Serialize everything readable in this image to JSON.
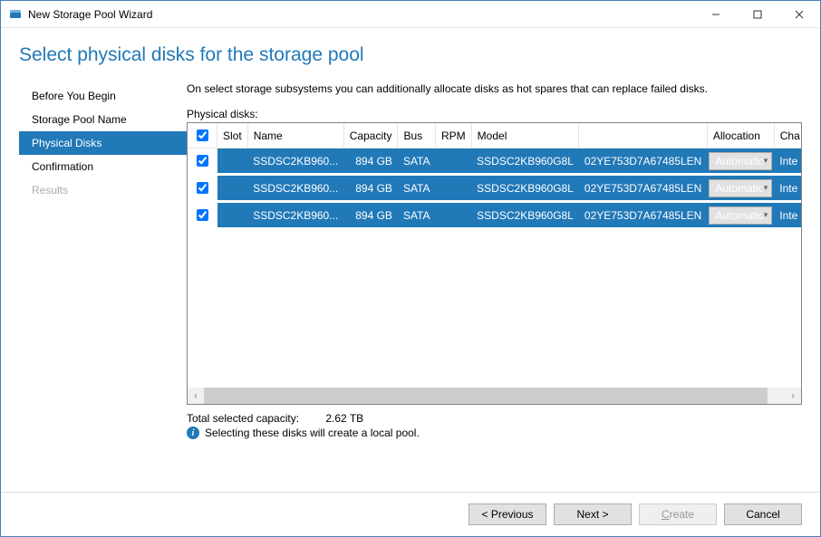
{
  "window": {
    "title": "New Storage Pool Wizard"
  },
  "page": {
    "title": "Select physical disks for the storage pool",
    "intro": "On select storage subsystems you can additionally allocate disks as hot spares that can replace failed disks.",
    "table_label": "Physical disks:"
  },
  "sidebar": {
    "items": [
      {
        "label": "Before You Begin",
        "state": "normal"
      },
      {
        "label": "Storage Pool Name",
        "state": "normal"
      },
      {
        "label": "Physical Disks",
        "state": "active"
      },
      {
        "label": "Confirmation",
        "state": "normal"
      },
      {
        "label": "Results",
        "state": "disabled"
      }
    ]
  },
  "columns": {
    "chk": "",
    "slot": "Slot",
    "name": "Name",
    "capacity": "Capacity",
    "bus": "Bus",
    "rpm": "RPM",
    "model": "Model",
    "allocation": "Allocation",
    "chassis": "Cha"
  },
  "rows": [
    {
      "checked": true,
      "slot": "",
      "name": "SSDSC2KB960...",
      "capacity": "894 GB",
      "bus": "SATA",
      "rpm": "",
      "model": "SSDSC2KB960G8L",
      "serial": "02YE753D7A67485LEN",
      "allocation": "Automatic",
      "chassis": "Inte"
    },
    {
      "checked": true,
      "slot": "",
      "name": "SSDSC2KB960...",
      "capacity": "894 GB",
      "bus": "SATA",
      "rpm": "",
      "model": "SSDSC2KB960G8L",
      "serial": "02YE753D7A67485LEN",
      "allocation": "Automatic",
      "chassis": "Inte"
    },
    {
      "checked": true,
      "slot": "",
      "name": "SSDSC2KB960...",
      "capacity": "894 GB",
      "bus": "SATA",
      "rpm": "",
      "model": "SSDSC2KB960G8L",
      "serial": "02YE753D7A67485LEN",
      "allocation": "Automatic",
      "chassis": "Inte"
    }
  ],
  "summary": {
    "capacity_label": "Total selected capacity:",
    "capacity_value": "2.62 TB",
    "info_text": "Selecting these disks will create a local pool."
  },
  "footer": {
    "previous": "< Previous",
    "next": "Next >",
    "create": "Create",
    "cancel": "Cancel"
  }
}
